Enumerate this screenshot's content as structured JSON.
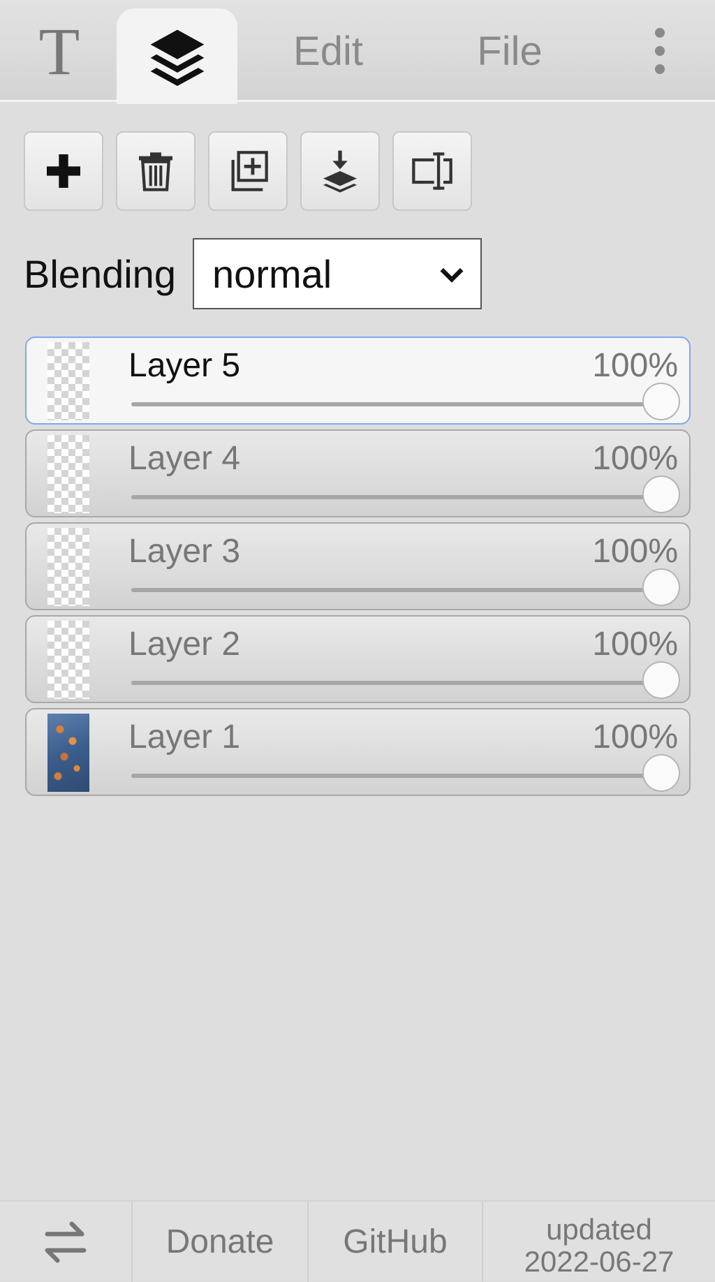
{
  "tabs": {
    "text_glyph": "T",
    "layers_icon": "layers-icon",
    "edit_label": "Edit",
    "file_label": "File",
    "more_icon": "vertical-dots-icon"
  },
  "toolbar": [
    {
      "icon": "plus-icon"
    },
    {
      "icon": "trash-icon"
    },
    {
      "icon": "duplicate-layer-icon"
    },
    {
      "icon": "merge-down-icon"
    },
    {
      "icon": "resize-canvas-icon"
    }
  ],
  "blending": {
    "label": "Blending",
    "value": "normal"
  },
  "layers": [
    {
      "name": "Layer 5",
      "opacity": "100%",
      "opacity_value": 1.0,
      "active": true,
      "thumb": "transparent"
    },
    {
      "name": "Layer 4",
      "opacity": "100%",
      "opacity_value": 1.0,
      "active": false,
      "thumb": "transparent"
    },
    {
      "name": "Layer 3",
      "opacity": "100%",
      "opacity_value": 1.0,
      "active": false,
      "thumb": "transparent"
    },
    {
      "name": "Layer 2",
      "opacity": "100%",
      "opacity_value": 1.0,
      "active": false,
      "thumb": "transparent"
    },
    {
      "name": "Layer 1",
      "opacity": "100%",
      "opacity_value": 1.0,
      "active": false,
      "thumb": "photo"
    }
  ],
  "footer": {
    "swap_icon": "swap-arrows-icon",
    "donate": "Donate",
    "github": "GitHub",
    "updated_label": "updated",
    "updated_date": "2022-06-27"
  },
  "colors": {
    "active_border": "#7fa8ef",
    "background": "#dedede"
  }
}
